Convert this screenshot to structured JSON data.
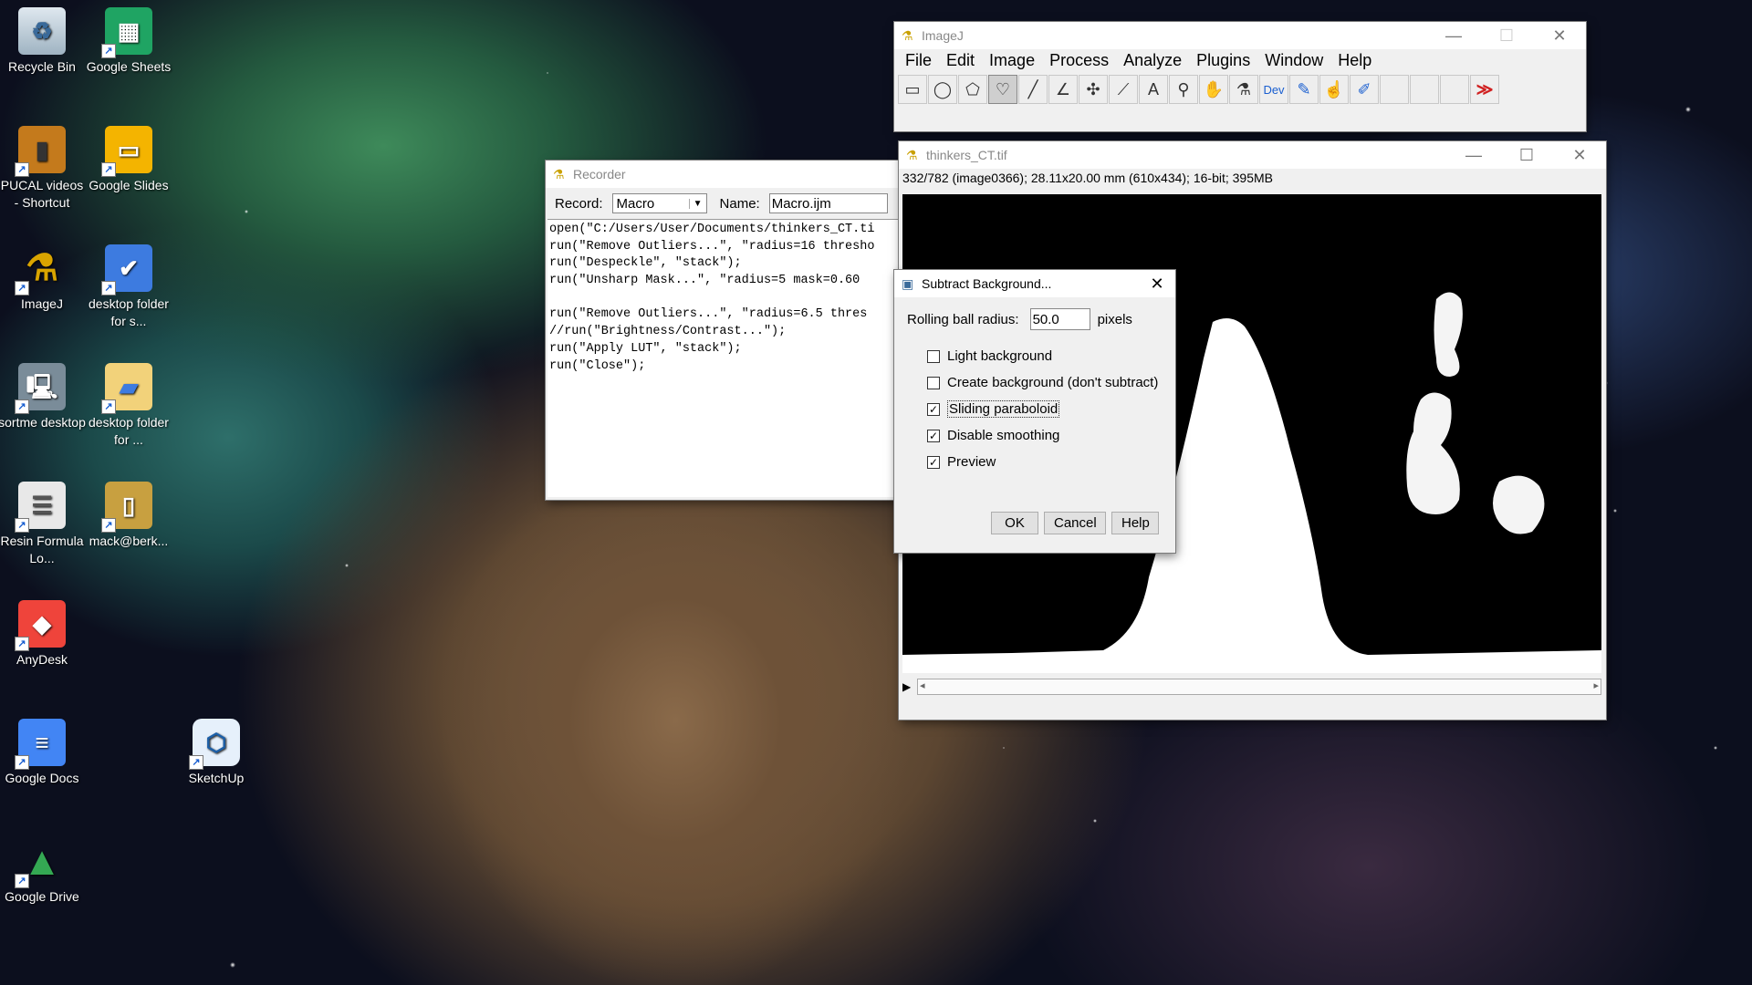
{
  "desktop": {
    "icons": [
      {
        "label": "Recycle Bin",
        "icon": "recycle-bin-icon"
      },
      {
        "label": "Google Sheets",
        "icon": "google-sheets-icon"
      },
      {
        "label": "PUCAL videos - Shortcut",
        "icon": "folder-icon"
      },
      {
        "label": "Google Slides",
        "icon": "google-slides-icon"
      },
      {
        "label": "ImageJ",
        "icon": "microscope-icon"
      },
      {
        "label": "desktop folder for s...",
        "icon": "monitor-icon"
      },
      {
        "label": "sortme desktop",
        "icon": "computer-icon"
      },
      {
        "label": "desktop folder for ...",
        "icon": "folder-icon"
      },
      {
        "label": "Resin Formula Lo...",
        "icon": "spreadsheet-icon"
      },
      {
        "label": "mack@berk...",
        "icon": "device-icon"
      },
      {
        "label": "AnyDesk",
        "icon": "anydesk-icon"
      },
      {
        "label": "Google Docs",
        "icon": "google-docs-icon"
      },
      {
        "label": "SketchUp",
        "icon": "sketchup-icon"
      },
      {
        "label": "Google Drive",
        "icon": "google-drive-icon"
      }
    ]
  },
  "imagej": {
    "title": "ImageJ",
    "menu": [
      "File",
      "Edit",
      "Image",
      "Process",
      "Analyze",
      "Plugins",
      "Window",
      "Help"
    ],
    "tools": [
      "rectangle-tool-icon",
      "oval-tool-icon",
      "polygon-tool-icon",
      "freehand-tool-icon",
      "line-tool-icon",
      "angle-tool-icon",
      "point-tool-icon",
      "wand-tool-icon",
      "text-tool-icon",
      "magnifier-icon",
      "hand-icon",
      "dropper-icon",
      "dev-menu",
      "brush-icon",
      "flood-fill-icon",
      "pencil-icon",
      "empty",
      "empty",
      "empty",
      "more-tools-icon"
    ],
    "dev_label": "Dev"
  },
  "recorder": {
    "title": "Recorder",
    "record_label": "Record:",
    "record_value": "Macro",
    "name_label": "Name:",
    "name_value": "Macro.ijm",
    "lines": [
      "open(\"C:/Users/User/Documents/thinkers_CT.ti",
      "run(\"Remove Outliers...\", \"radius=16 thresho",
      "run(\"Despeckle\", \"stack\");",
      "run(\"Unsharp Mask...\", \"radius=5 mask=0.60",
      "",
      "run(\"Remove Outliers...\", \"radius=6.5 thres",
      "//run(\"Brightness/Contrast...\");",
      "run(\"Apply LUT\", \"stack\");",
      "run(\"Close\");"
    ]
  },
  "image_window": {
    "title": "thinkers_CT.tif",
    "info": "332/782 (image0366); 28.11x20.00 mm (610x434); 16-bit; 395MB"
  },
  "dialog": {
    "title": "Subtract Background...",
    "radius_label": "Rolling ball radius:",
    "radius_value": "50.0",
    "radius_unit": "pixels",
    "options": [
      {
        "label": "Light background",
        "checked": false
      },
      {
        "label": "Create background (don't subtract)",
        "checked": false
      },
      {
        "label": "Sliding paraboloid",
        "checked": true
      },
      {
        "label": "Disable smoothing",
        "checked": true
      },
      {
        "label": "Preview",
        "checked": true
      }
    ],
    "ok": "OK",
    "cancel": "Cancel",
    "help": "Help"
  }
}
